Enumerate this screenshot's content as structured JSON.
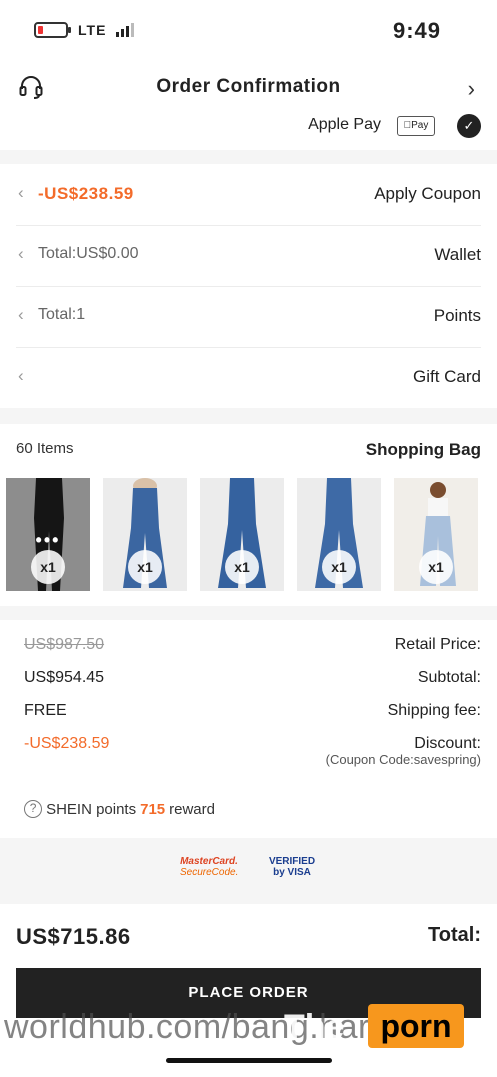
{
  "status_bar": {
    "time": "9:49",
    "network": "LTE"
  },
  "header": {
    "title": "Order Confirmation",
    "back_icon": "chevron-left-icon",
    "support_icon": "headset-icon"
  },
  "payment": {
    "method": "Apple Pay",
    "badge": "Pay"
  },
  "options": [
    {
      "label": "Apply Coupon",
      "value": "-US$238.59"
    },
    {
      "label": "Wallet",
      "value": "Total:US$0.00"
    },
    {
      "label": "Points",
      "value": "Total:1"
    },
    {
      "label": "Gift Card",
      "value": ""
    }
  ],
  "shopping_bag": {
    "title": "Shopping Bag",
    "count": "60 Items",
    "items": [
      {
        "qty": "x1",
        "color": "#d7cfc6",
        "jean": "#a9c0dc"
      },
      {
        "qty": "x1",
        "color": "#ececec",
        "jean": "#3e6aa6"
      },
      {
        "qty": "x1",
        "color": "#ececec",
        "jean": "#35629f"
      },
      {
        "qty": "x1",
        "color": "#ececec",
        "jean": "#3b66a1"
      },
      {
        "qty": "x1",
        "color": "#8d8d8d",
        "jean": "#151515"
      }
    ]
  },
  "summary": {
    "retail_label": "Retail Price:",
    "retail_value": "US$987.50",
    "subtotal_label": "Subtotal:",
    "subtotal_value": "US$954.45",
    "shipping_label": "Shipping fee:",
    "shipping_value": "FREE",
    "discount_label": "Discount:",
    "discount_value": "-US$238.59",
    "coupon_note": "(Coupon Code:savespring)"
  },
  "reward": {
    "prefix": "reward",
    "points": "715",
    "suffix": "SHEIN points"
  },
  "secure_logos": {
    "mastercard_line1": "MasterCard.",
    "mastercard_line2": "SecureCode.",
    "visa_line1": "VERIFIED",
    "visa_line2": "by VISA"
  },
  "total": {
    "label": "Total:",
    "value": "US$715.86"
  },
  "place_order_label": "PLACE ORDER",
  "watermark": {
    "url": "worldhub.com/bang.harlow",
    "brand_the": "The",
    "brand_porn": "porn"
  },
  "colors": {
    "accent": "#f36b2a",
    "button": "#222222"
  }
}
